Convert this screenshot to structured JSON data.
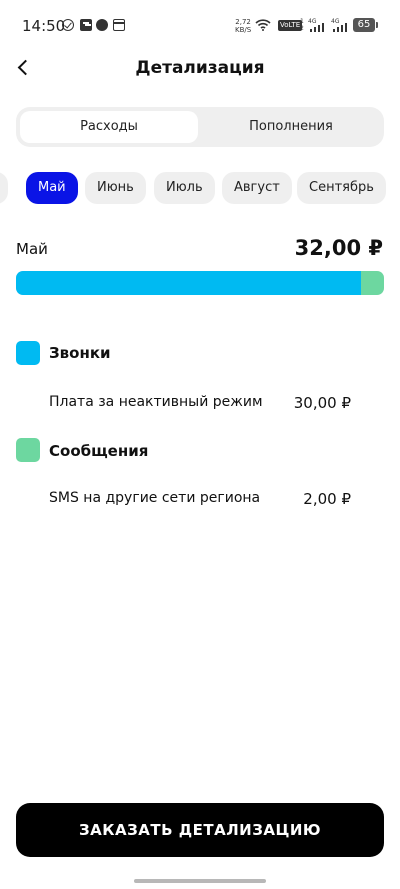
{
  "status_bar": {
    "time": "14:50",
    "net_speed_value": "2,72",
    "net_speed_unit": "KB/S",
    "volte": "VoLTE",
    "sim1_index": "1",
    "sim1_type": "4G",
    "sim2_index": "2",
    "sim2_type": "4G",
    "battery": "65"
  },
  "header": {
    "title": "Детализация"
  },
  "tabs": [
    {
      "label": "Расходы",
      "active": true
    },
    {
      "label": "Пополнения",
      "active": false
    }
  ],
  "months": [
    {
      "label": "ь"
    },
    {
      "label": "Май",
      "active": true
    },
    {
      "label": "Июнь"
    },
    {
      "label": "Июль"
    },
    {
      "label": "Август"
    },
    {
      "label": "Сентябрь"
    }
  ],
  "summary": {
    "month": "Май",
    "total": "32,00 ₽",
    "bar": [
      {
        "share": 0.9375,
        "color": "#00baf2"
      },
      {
        "share": 0.0625,
        "color": "#6dd7a0"
      }
    ]
  },
  "categories": [
    {
      "title": "Звонки",
      "color": "#00baf2",
      "items": [
        {
          "label": "Плата за неактивный режим",
          "amount": "30,00 ₽"
        }
      ]
    },
    {
      "title": "Сообщения",
      "color": "#6dd7a0",
      "items": [
        {
          "label": "SMS на другие сети региона",
          "amount": "2,00 ₽"
        }
      ]
    }
  ],
  "footer": {
    "order_label": "ЗАКАЗАТЬ ДЕТАЛИЗАЦИЮ"
  },
  "colors": {
    "accent": "#0a14e6",
    "calls": "#00baf2",
    "sms": "#6dd7a0"
  }
}
